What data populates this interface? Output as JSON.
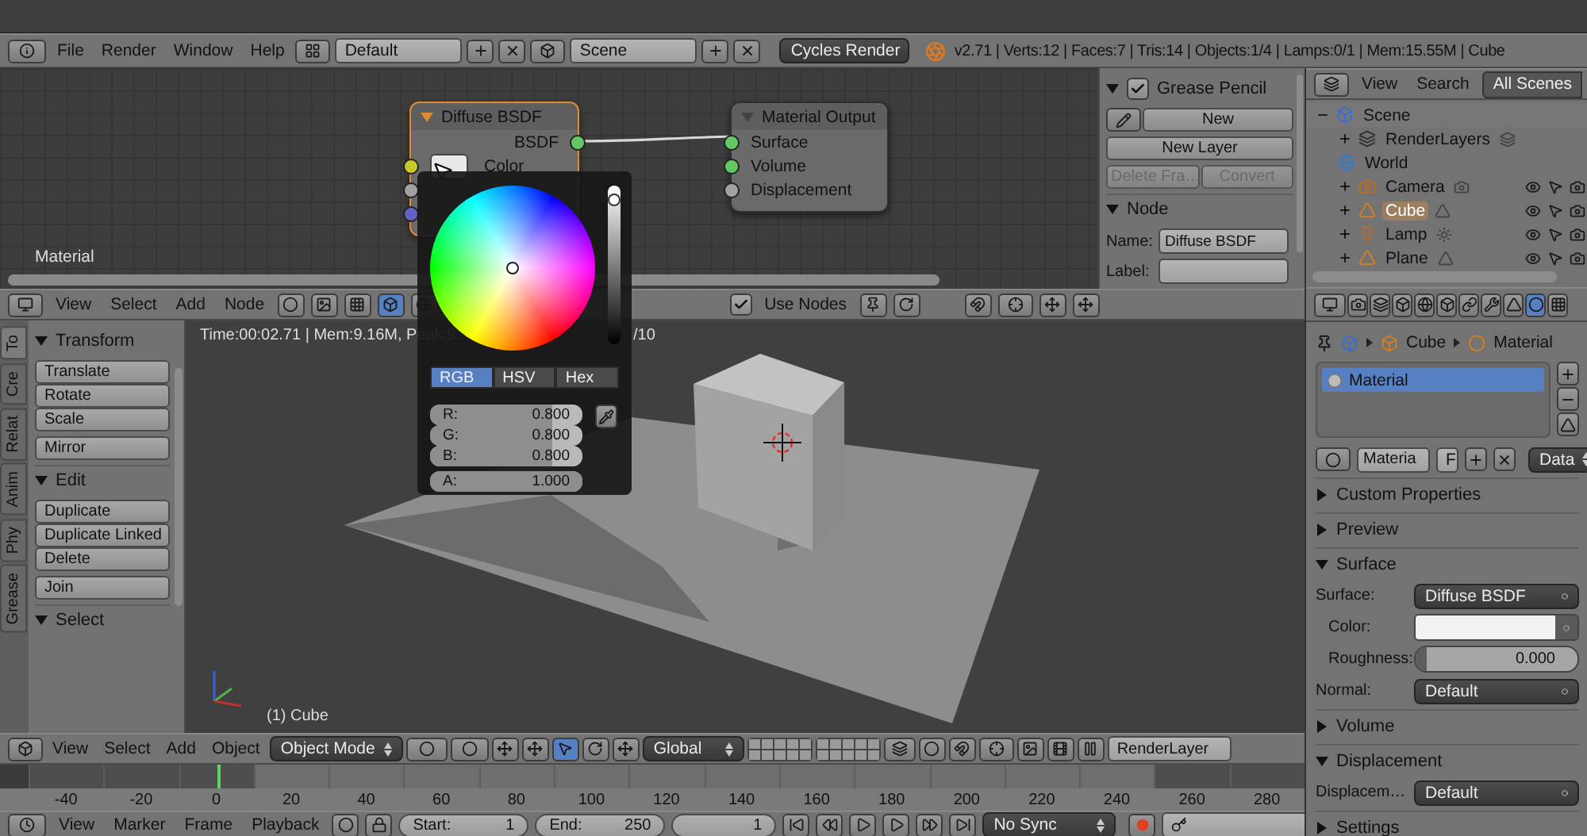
{
  "info_header": {
    "menus": [
      "File",
      "Render",
      "Window",
      "Help"
    ],
    "layout": "Default",
    "scene": "Scene",
    "engine": "Cycles Render",
    "stats": "v2.71 | Verts:12 | Faces:7 | Tris:14 | Objects:1/4 | Lamps:0/1 | Mem:15.55M | Cube"
  },
  "node_editor": {
    "nodes": [
      {
        "title": "Diffuse BSDF",
        "selected": true,
        "outputs": [
          "BSDF"
        ],
        "inputs": [
          "Color"
        ]
      },
      {
        "title": "Material Output",
        "selected": false,
        "inputs": [
          "Surface",
          "Volume",
          "Displacement"
        ]
      }
    ],
    "material_label": "Material",
    "header": {
      "menus": [
        "View",
        "Select",
        "Add",
        "Node"
      ],
      "use_nodes": {
        "label": "Use Nodes",
        "checked": true
      }
    },
    "sidebar": {
      "grease_pencil": {
        "title": "Grease Pencil",
        "expanded": true,
        "checked": true,
        "new": "New",
        "buttons": [
          {
            "label": "New Layer",
            "disabled": false
          },
          {
            "label": "Delete Fra…",
            "disabled": true
          },
          {
            "label": "Convert",
            "disabled": true
          }
        ]
      },
      "node_panel": {
        "title": "Node",
        "expanded": true,
        "name_label": "Name:",
        "name": "Diffuse BSDF",
        "label_label": "Label:"
      }
    }
  },
  "color_picker": {
    "value_slider": {
      "level": 0.95
    },
    "modes": [
      {
        "label": "RGB",
        "selected": true
      },
      {
        "label": "HSV",
        "selected": false
      },
      {
        "label": "Hex",
        "selected": false
      }
    ],
    "channels": [
      {
        "label": "R:",
        "value": "0.800",
        "level": 0.8
      },
      {
        "label": "G:",
        "value": "0.800",
        "level": 0.8
      },
      {
        "label": "B:",
        "value": "0.800",
        "level": 0.8
      },
      {
        "label": "A:",
        "value": "1.000",
        "level": 1
      }
    ]
  },
  "tool_shelf": {
    "tabs": [
      {
        "label": "To",
        "selected": true
      },
      {
        "label": "Cre",
        "selected": false
      },
      {
        "label": "Relat",
        "selected": false
      },
      {
        "label": "Anim",
        "selected": false
      },
      {
        "label": "Phy",
        "selected": false
      },
      {
        "label": "Grease",
        "selected": false
      }
    ],
    "panels": [
      {
        "title": "Transform",
        "expanded": true,
        "groups": [
          [
            "Translate",
            "Rotate",
            "Scale"
          ],
          [
            "Mirror"
          ]
        ]
      },
      {
        "title": "Edit",
        "expanded": true,
        "groups": [
          [
            "Duplicate",
            "Duplicate Linked",
            "Delete"
          ],
          [
            "Join"
          ]
        ]
      },
      {
        "title": "Select",
        "expanded": true
      }
    ]
  },
  "viewport": {
    "render_info": "Time:00:02.71 | Mem:9.16M, Peak:9.",
    "render_info_end": "/10",
    "object_label": "(1) Cube"
  },
  "view3d_header": {
    "menus": [
      "View",
      "Select",
      "Add",
      "Object"
    ],
    "mode": "Object Mode",
    "orientation": "Global",
    "render_layer": "RenderLayer"
  },
  "timeline": {
    "ticks": [
      {
        "label": "-40",
        "current": false
      },
      {
        "label": "-20",
        "current": false
      },
      {
        "label": "0",
        "current": true
      },
      {
        "label": "20",
        "current": false
      },
      {
        "label": "40",
        "current": false
      },
      {
        "label": "60",
        "current": false
      },
      {
        "label": "80",
        "current": false
      },
      {
        "label": "100",
        "current": false
      },
      {
        "label": "120",
        "current": false
      },
      {
        "label": "140",
        "current": false
      },
      {
        "label": "160",
        "current": false
      },
      {
        "label": "180",
        "current": false
      },
      {
        "label": "200",
        "current": false
      },
      {
        "label": "220",
        "current": false
      },
      {
        "label": "240",
        "current": false
      },
      {
        "label": "260",
        "current": false
      },
      {
        "label": "280",
        "current": false
      }
    ]
  },
  "timeline_header": {
    "menus": [
      "View",
      "Marker",
      "Frame",
      "Playback"
    ],
    "start_label": "Start:",
    "start": "1",
    "end_label": "End:",
    "end": "250",
    "current": "1",
    "sync": "No Sync"
  },
  "outliner": {
    "menus": [
      "View",
      "Search"
    ],
    "filter": "All Scenes",
    "tree": [
      {
        "name": "Scene",
        "kind": "scene",
        "selected": false,
        "expanded": true,
        "children": [
          {
            "name": "RenderLayers",
            "kind": "render_layers",
            "selected": false
          },
          {
            "name": "World",
            "kind": "world",
            "selected": false
          },
          {
            "name": "Camera",
            "kind": "camera",
            "selected": false
          },
          {
            "name": "Cube",
            "kind": "mesh",
            "selected": true
          },
          {
            "name": "Lamp",
            "kind": "lamp",
            "selected": false
          },
          {
            "name": "Plane",
            "kind": "mesh",
            "selected": false
          }
        ]
      }
    ]
  },
  "properties": {
    "context_tabs": [
      {
        "kind": "render",
        "selected": false
      },
      {
        "kind": "layers",
        "selected": false
      },
      {
        "kind": "scene",
        "selected": false
      },
      {
        "kind": "world",
        "selected": false
      },
      {
        "kind": "object",
        "selected": false
      },
      {
        "kind": "constraints",
        "selected": false
      },
      {
        "kind": "modifiers",
        "selected": false
      },
      {
        "kind": "data",
        "selected": false
      },
      {
        "kind": "material",
        "selected": true
      },
      {
        "kind": "texture",
        "selected": false
      }
    ],
    "breadcrumb": [
      "Cube",
      "Material"
    ],
    "slots": [
      {
        "name": "Material",
        "selected": true
      }
    ],
    "material_field": "Materia",
    "fake_user": "F",
    "link": "Data",
    "panels": [
      {
        "title": "Custom Properties",
        "expanded": false
      },
      {
        "title": "Preview",
        "expanded": false
      },
      {
        "title": "Surface",
        "expanded": true,
        "rows": [
          {
            "kind": "menu",
            "label": "Surface:",
            "value": "Diffuse BSDF"
          },
          {
            "kind": "color",
            "label": "Color:"
          },
          {
            "kind": "slider",
            "label": "Roughness:",
            "value": "0.000",
            "level": 0
          },
          {
            "kind": "menu",
            "label": "Normal:",
            "value": "Default"
          }
        ]
      },
      {
        "title": "Volume",
        "expanded": false
      },
      {
        "title": "Displacement",
        "expanded": true,
        "rows": [
          {
            "kind": "menu",
            "label": "Displacem…",
            "value": "Default"
          }
        ]
      },
      {
        "title": "Settings",
        "expanded": false
      }
    ]
  }
}
